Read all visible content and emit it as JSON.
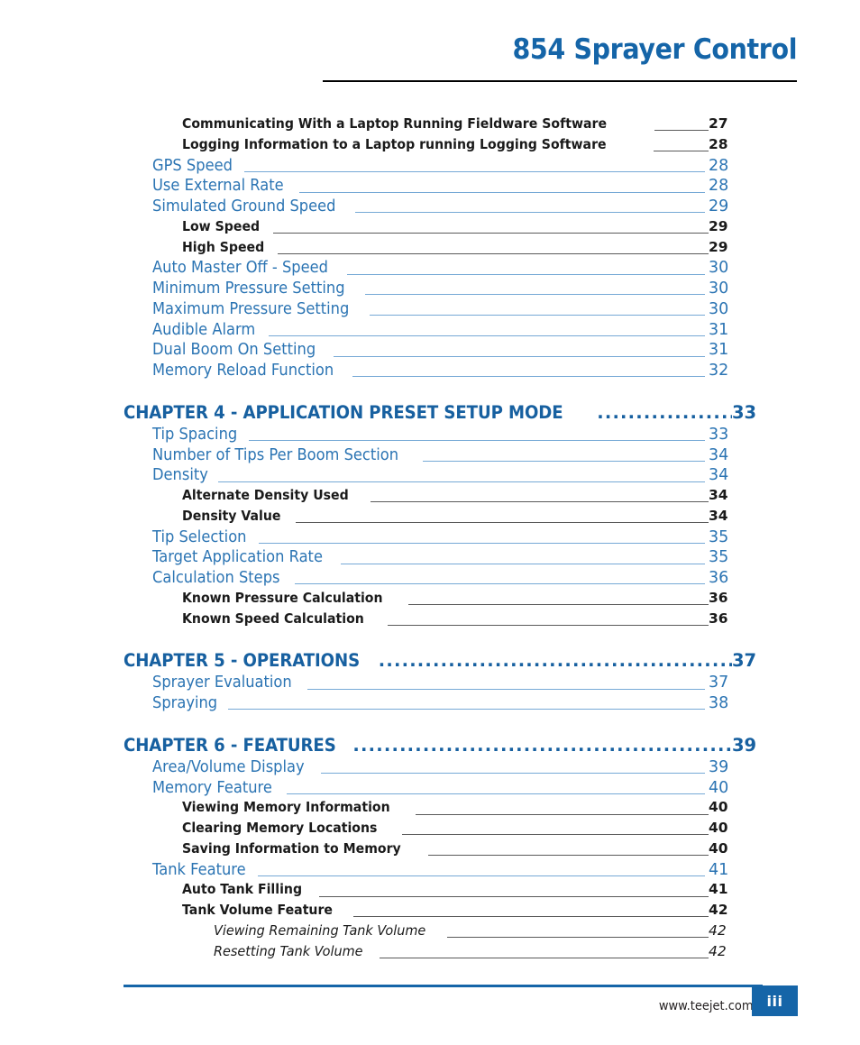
{
  "header": {
    "title": "854 Sprayer Control"
  },
  "toc": {
    "entries": [
      {
        "level": 2,
        "label": "Communicating With a Laptop Running Fieldware Software",
        "page": "27",
        "gap": false
      },
      {
        "level": 2,
        "label": "Logging Information to a Laptop running Logging Software",
        "page": "28",
        "gap": false
      },
      {
        "level": 1,
        "label": "GPS Speed",
        "page": "28",
        "gap": false
      },
      {
        "level": 1,
        "label": "Use External Rate",
        "page": "28",
        "gap": false
      },
      {
        "level": 1,
        "label": "Simulated Ground Speed",
        "page": "29",
        "gap": false
      },
      {
        "level": 2,
        "label": "Low Speed",
        "page": "29",
        "gap": false
      },
      {
        "level": 2,
        "label": "High Speed",
        "page": "29",
        "gap": false
      },
      {
        "level": 1,
        "label": "Auto Master Off - Speed",
        "page": "30",
        "gap": false
      },
      {
        "level": 1,
        "label": "Minimum Pressure Setting",
        "page": "30",
        "gap": false
      },
      {
        "level": 1,
        "label": "Maximum Pressure Setting",
        "page": "30",
        "gap": false
      },
      {
        "level": 1,
        "label": "Audible Alarm",
        "page": "31",
        "gap": false
      },
      {
        "level": 1,
        "label": "Dual Boom On Setting",
        "page": "31",
        "gap": false
      },
      {
        "level": 1,
        "label": "Memory Reload Function",
        "page": "32",
        "gap": false
      },
      {
        "level": 0,
        "label": "CHAPTER 4 - APPLICATION PRESET SETUP MODE",
        "page": "33",
        "gap": true
      },
      {
        "level": 1,
        "label": "Tip Spacing",
        "page": "33",
        "gap": false
      },
      {
        "level": 1,
        "label": "Number of Tips Per Boom Section",
        "page": "34",
        "gap": false
      },
      {
        "level": 1,
        "label": "Density",
        "page": "34",
        "gap": false
      },
      {
        "level": 2,
        "label": "Alternate Density Used",
        "page": "34",
        "gap": false
      },
      {
        "level": 2,
        "label": "Density Value",
        "page": "34",
        "gap": false
      },
      {
        "level": 1,
        "label": "Tip Selection",
        "page": "35",
        "gap": false
      },
      {
        "level": 1,
        "label": "Target Application Rate",
        "page": "35",
        "gap": false
      },
      {
        "level": 1,
        "label": "Calculation Steps",
        "page": "36",
        "gap": false
      },
      {
        "level": 2,
        "label": "Known Pressure Calculation",
        "page": "36",
        "gap": false
      },
      {
        "level": 2,
        "label": "Known Speed Calculation",
        "page": "36",
        "gap": false
      },
      {
        "level": 0,
        "label": "CHAPTER 5 - OPERATIONS",
        "page": "37",
        "gap": true
      },
      {
        "level": 1,
        "label": "Sprayer Evaluation",
        "page": "37",
        "gap": false
      },
      {
        "level": 1,
        "label": "Spraying",
        "page": "38",
        "gap": false
      },
      {
        "level": 0,
        "label": "CHAPTER 6 - FEATURES",
        "page": "39",
        "gap": true
      },
      {
        "level": 1,
        "label": "Area/Volume Display",
        "page": "39",
        "gap": false
      },
      {
        "level": 1,
        "label": "Memory Feature",
        "page": "40",
        "gap": false
      },
      {
        "level": 2,
        "label": "Viewing Memory Information",
        "page": "40",
        "gap": false
      },
      {
        "level": 2,
        "label": "Clearing Memory Locations",
        "page": "40",
        "gap": false
      },
      {
        "level": 2,
        "label": "Saving Information to Memory",
        "page": "40",
        "gap": false
      },
      {
        "level": 1,
        "label": "Tank Feature",
        "page": "41",
        "gap": false
      },
      {
        "level": 2,
        "label": "Auto Tank Filling",
        "page": "41",
        "gap": false
      },
      {
        "level": 2,
        "label": "Tank Volume Feature",
        "page": "42",
        "gap": false
      },
      {
        "level": 3,
        "label": "Viewing Remaining Tank Volume",
        "page": "42",
        "gap": false
      },
      {
        "level": 3,
        "label": "Resetting Tank Volume",
        "page": "42",
        "gap": false
      }
    ]
  },
  "footer": {
    "url": "www.teejet.com",
    "page_label": "iii"
  },
  "colors": {
    "title_blue": "#1565a8",
    "chapter_blue": "#1760a0",
    "entry_blue": "#2b74b3",
    "leader_blue": "#76a9d6",
    "leader_gray": "#5a5a5a",
    "footer_blue": "#1565a8"
  }
}
